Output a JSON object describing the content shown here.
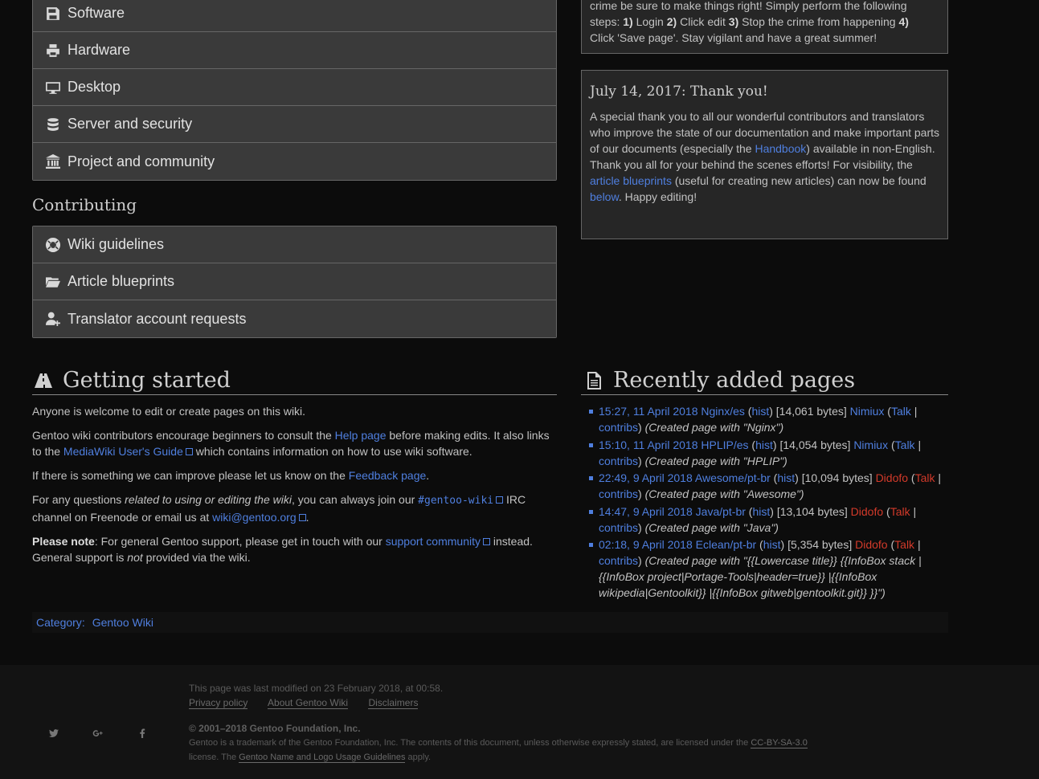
{
  "nav_top": [
    {
      "icon": "save-icon",
      "label": "Software"
    },
    {
      "icon": "printer-icon",
      "label": "Hardware"
    },
    {
      "icon": "desktop-icon",
      "label": "Desktop"
    },
    {
      "icon": "database-icon",
      "label": "Server and security"
    },
    {
      "icon": "bank-icon",
      "label": "Project and community"
    }
  ],
  "contributing": {
    "title": "Contributing",
    "items": [
      {
        "icon": "life-ring-icon",
        "label": "Wiki guidelines"
      },
      {
        "icon": "folder-open-icon",
        "label": "Article blueprints"
      },
      {
        "icon": "user-plus-icon",
        "label": "Translator account requests"
      }
    ]
  },
  "news1": {
    "line1": "crime be sure to make things right! Simply perform the following",
    "steps_prefix": "steps: ",
    "s1n": "1)",
    "s1": " Login ",
    "s2n": "2)",
    "s2": " Click edit ",
    "s3n": "3)",
    "s3": " Stop the crime from happening ",
    "s4n": "4)",
    "line3": "Click 'Save page'. Stay vigilant and have a great summer!"
  },
  "news2": {
    "title": "July 14, 2017: Thank you!",
    "t1": "A special thank you to all our wonderful contributors and translators who improve the state of our documentation and make important parts of our documents (especially the ",
    "handbook": "Handbook",
    "t2": ") available in non-English. Thank you all for your behind the scenes efforts! For visibility, the ",
    "blueprints": "article blueprints",
    "t3": " (useful for creating new articles) can now be found ",
    "below": "below",
    "t4": ". Happy editing!"
  },
  "getting_started": {
    "title": "Getting started",
    "p1": "Anyone is welcome to edit or create pages on this wiki.",
    "p2a": "Gentoo wiki contributors encourage beginners to consult the ",
    "help_link": "Help page",
    "p2b": " before making edits. It also links to the ",
    "mw_link": "MediaWiki User's Guide",
    "p2c": " which contains information on how to use wiki software.",
    "p3a": "If there is something we can improve please let us know on the ",
    "feedback_link": "Feedback page",
    "p3b": ".",
    "p4a": "For any questions ",
    "p4i": "related to using or editing the wiki",
    "p4b": ", you can always join our ",
    "irc": "#gentoo-wiki",
    "p4c": " IRC channel on Freenode or email us at ",
    "email": "wiki@gentoo.org",
    "p4d": ".",
    "p5b": "Please note",
    "p5a": ": For general Gentoo support, please get in touch with our ",
    "support_link": "support community",
    "p5c": " instead. General support is ",
    "p5i": "not",
    "p5d": " provided via the wiki."
  },
  "recent": {
    "title": "Recently added pages",
    "hist": "hist",
    "talk": "Talk",
    "contribs": "contribs",
    "items": [
      {
        "ts": "15:27, 11 April 2018",
        "page": "Nginx/es",
        "size": "[14,061 bytes]",
        "user": "Nimiux",
        "summary": "(Created page with \"Nginx\")"
      },
      {
        "ts": "15:10, 11 April 2018",
        "page": "HPLIP/es",
        "size": "[14,054 bytes]",
        "user": "Nimiux",
        "summary": "(Created page with \"HPLIP\")"
      },
      {
        "ts": "22:49, 9 April 2018",
        "page": "Awesome/pt-br",
        "size": "[10,094 bytes]",
        "user": "Didofo",
        "summary": "(Created page with \"Awesome\")"
      },
      {
        "ts": "14:47, 9 April 2018",
        "page": "Java/pt-br",
        "size": "[13,104 bytes]",
        "user": "Didofo",
        "summary": "(Created page with \"Java\")"
      },
      {
        "ts": "02:18, 9 April 2018",
        "page": "Eclean/pt-br",
        "size": "[5,354 bytes]",
        "user": "Didofo",
        "summary": "(Created page with \"{{Lowercase title}} {{InfoBox stack |{{InfoBox project|Portage-Tools|header=true}} |{{InfoBox wikipedia|Gentoolkit}} |{{InfoBox gitweb|gentoolkit.git}} }}\")"
      }
    ]
  },
  "category": {
    "label": "Category",
    "colon": ":",
    "value": "Gentoo Wiki"
  },
  "footer": {
    "modified": "This page was last modified on 23 February 2018, at 00:58.",
    "links": [
      "Privacy policy",
      "About Gentoo Wiki",
      "Disclaimers"
    ],
    "copyright": "© 2001–2018 Gentoo Foundation, Inc.",
    "lic1": "Gentoo is a trademark of the Gentoo Foundation, Inc. The contents of this document, unless otherwise expressly stated, are licensed under the ",
    "cc": "CC-BY-SA-3.0",
    "lic2": " license. The ",
    "guidelines": "Gentoo Name and Logo Usage Guidelines",
    "lic3": " apply.",
    "social": [
      "twitter-icon",
      "google-plus-icon",
      "facebook-icon"
    ]
  }
}
